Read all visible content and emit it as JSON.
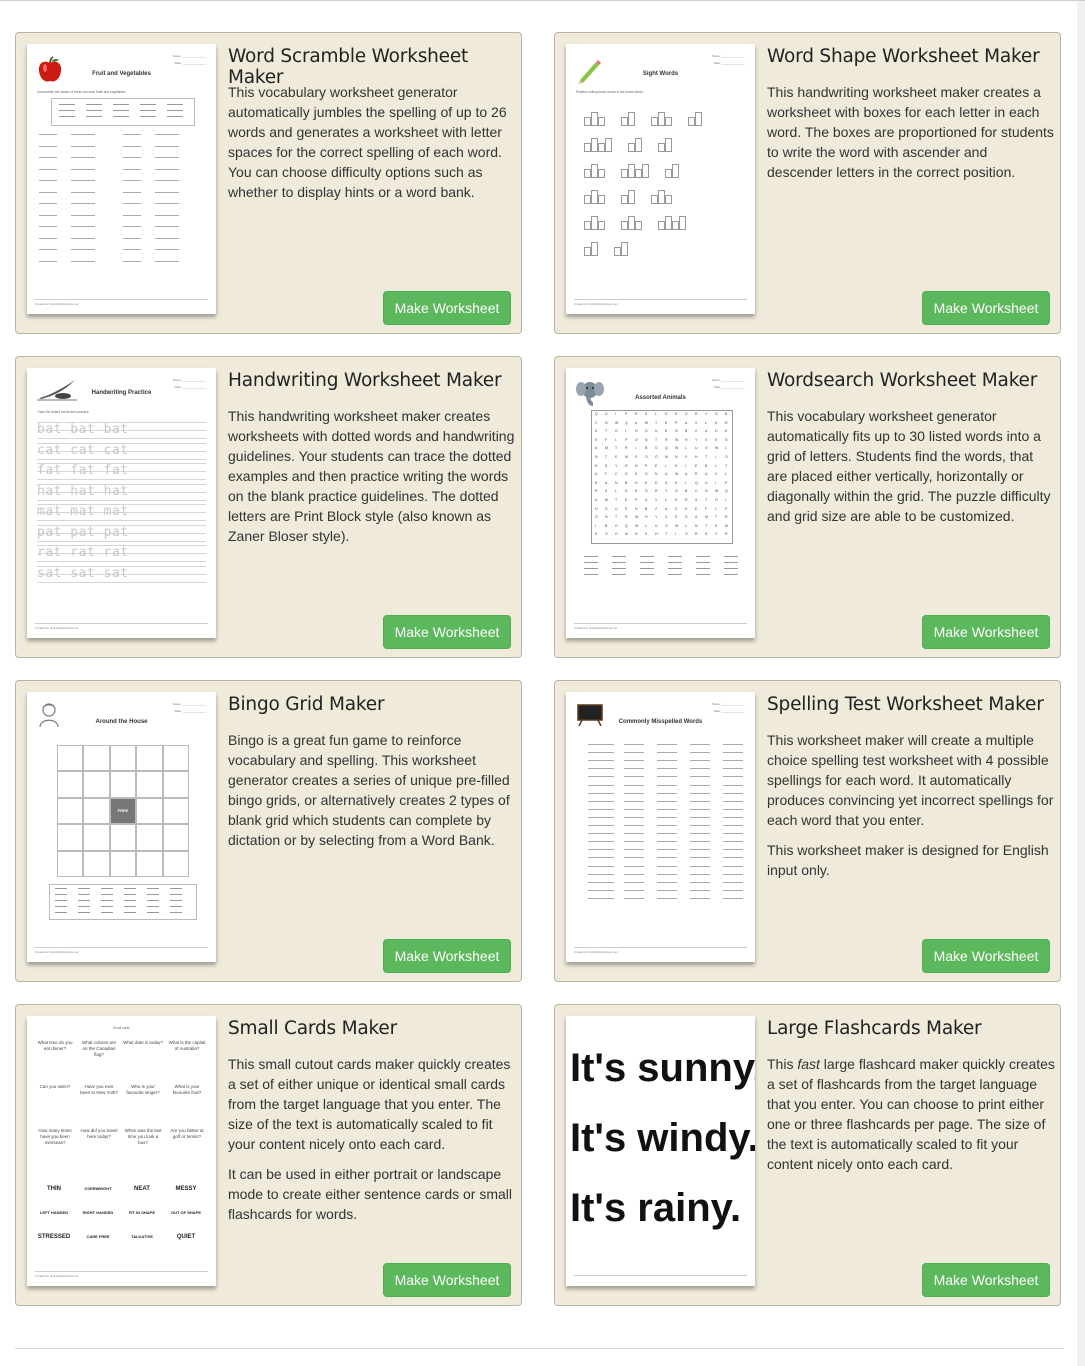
{
  "cards": [
    {
      "title": "Word Scramble Worksheet Maker",
      "desc": [
        "This vocabulary worksheet generator automatically jumbles the spelling of up to 26 words and generates a worksheet with letter spaces for the correct spelling of each word. You can choose difficulty options such as whether to display hints or a word bank."
      ],
      "button": "Make Worksheet",
      "thumb": {
        "kind": "scramble",
        "title": "Fruit and Vegetables",
        "icon": "apple-icon"
      }
    },
    {
      "title": "Word Shape Worksheet Maker",
      "desc": [
        "This handwriting worksheet maker creates a worksheet with boxes for each letter in each word. The boxes are proportioned for students to write the word with ascender and descender letters in the correct position."
      ],
      "button": "Make Worksheet",
      "thumb": {
        "kind": "shape",
        "title": "Sight Words",
        "icon": "pencil-icon"
      }
    },
    {
      "title": "Handwriting Worksheet Maker",
      "desc": [
        "This handwriting worksheet maker creates worksheets with dotted words and handwriting guidelines. Your students can trace the dotted examples and then practice writing the words on the blank practice guidelines. The dotted letters are Print Block style (also known as Zaner Bloser style)."
      ],
      "button": "Make Worksheet",
      "thumb": {
        "kind": "handwriting",
        "title": "Handwriting Practice",
        "icon": "quill-icon",
        "rows": [
          "bat bat bat",
          "cat cat cat",
          "fat fat fat",
          "hat hat hat",
          "mat mat mat",
          "pat pat pat",
          "rat rat rat",
          "sat sat sat"
        ]
      }
    },
    {
      "title": "Wordsearch Worksheet Maker",
      "desc": [
        "This vocabulary worksheet generator automatically fits up to 30 listed words into a grid of letters. Students find the words, that are placed either vertically, horizontally or diagonally within the grid. The puzzle difficulty and grid size are able to be customized."
      ],
      "button": "Make Worksheet",
      "thumb": {
        "kind": "wordsearch",
        "title": "Assorted Animals",
        "icon": "elephant-icon"
      }
    },
    {
      "title": "Bingo Grid Maker",
      "desc": [
        "Bingo is a great fun game to reinforce vocabulary and spelling. This worksheet generator creates a series of unique pre-filled bingo grids, or alternatively creates 2 types of blank grid which students can complete by dictation or by selecting from a Word Bank."
      ],
      "button": "Make Worksheet",
      "thumb": {
        "kind": "bingo",
        "title": "Around the House",
        "icon": "person-icon",
        "free": "FREE"
      }
    },
    {
      "title": "Spelling Test Worksheet Maker",
      "desc": [
        "This worksheet maker will create a multiple choice spelling test worksheet with 4 possible spellings for each word. It automatically produces convincing yet incorrect spellings for each word that you enter.",
        "This worksheet maker is designed for English input only."
      ],
      "button": "Make Worksheet",
      "thumb": {
        "kind": "spelling",
        "title": "Commonly Misspelled Words",
        "icon": "chalkboard-icon"
      }
    },
    {
      "title": "Small Cards Maker",
      "desc": [
        "This small cutout cards maker quickly creates a set of either unique or identical small cards from the target language that you enter. The size of the text is automatically scaled to fit your content nicely onto each card.",
        "It can be used in either portrait or landscape mode to create either sentence cards or small flashcards for words."
      ],
      "button": "Make Worksheet",
      "thumb": {
        "kind": "cards",
        "questions": [
          "What time do you eat dinner?",
          "What colours are on the Canadian flag?",
          "What date is today?",
          "What is the capital of Australia?",
          "Can you swim?",
          "Have you ever been to New York?",
          "Who is your favourite singer?",
          "What is your favourite fruit?",
          "How many times have you been overseas?",
          "How did you travel here today?",
          "When was the last time you took a bus?",
          "Are you better at golf or tennis?"
        ],
        "words": [
          "THIN",
          "OVERWEIGHT",
          "NEAT",
          "MESSY",
          "LEFT HANDED",
          "RIGHT HANDED",
          "FIT IN SHAPE",
          "OUT OF SHAPE",
          "STRESSED",
          "CARE FREE",
          "TALKATIVE",
          "QUIET"
        ]
      }
    },
    {
      "title": "Large Flashcards Maker",
      "desc_html": true,
      "desc_parts": [
        "This ",
        "fast",
        " large flashcard maker quickly creates a set of flashcards from the target language that you enter. You can choose to print either one or three flashcards per page. The size of the text is automatically scaled to fit your content nicely onto each card."
      ],
      "button": "Make Worksheet",
      "thumb": {
        "kind": "flash",
        "lines": [
          "It's sunny.",
          "It's windy.",
          "It's rainy."
        ]
      }
    }
  ]
}
